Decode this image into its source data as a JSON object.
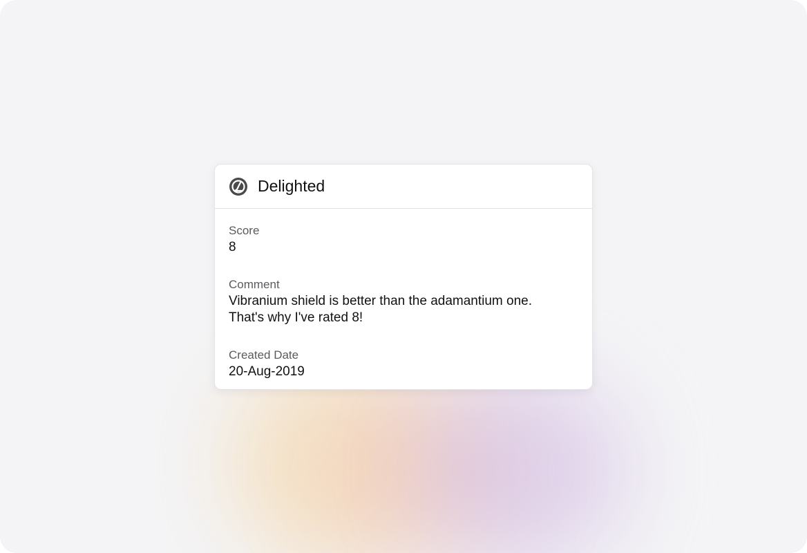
{
  "card": {
    "icon": "delighted-logo-icon",
    "title": "Delighted",
    "fields": [
      {
        "label": "Score",
        "value": "8"
      },
      {
        "label": "Comment",
        "value_line1": "Vibranium shield is better than the adamantium one.",
        "value_line2": "That's why I've rated 8!"
      },
      {
        "label": "Created Date",
        "value": "20-Aug-2019"
      }
    ]
  },
  "colors": {
    "background": "#f4f4f6",
    "card": "#ffffff",
    "border": "#e3e3e6",
    "label": "#5a5a5f",
    "text": "#111111",
    "logo": "#4a4a4a"
  }
}
